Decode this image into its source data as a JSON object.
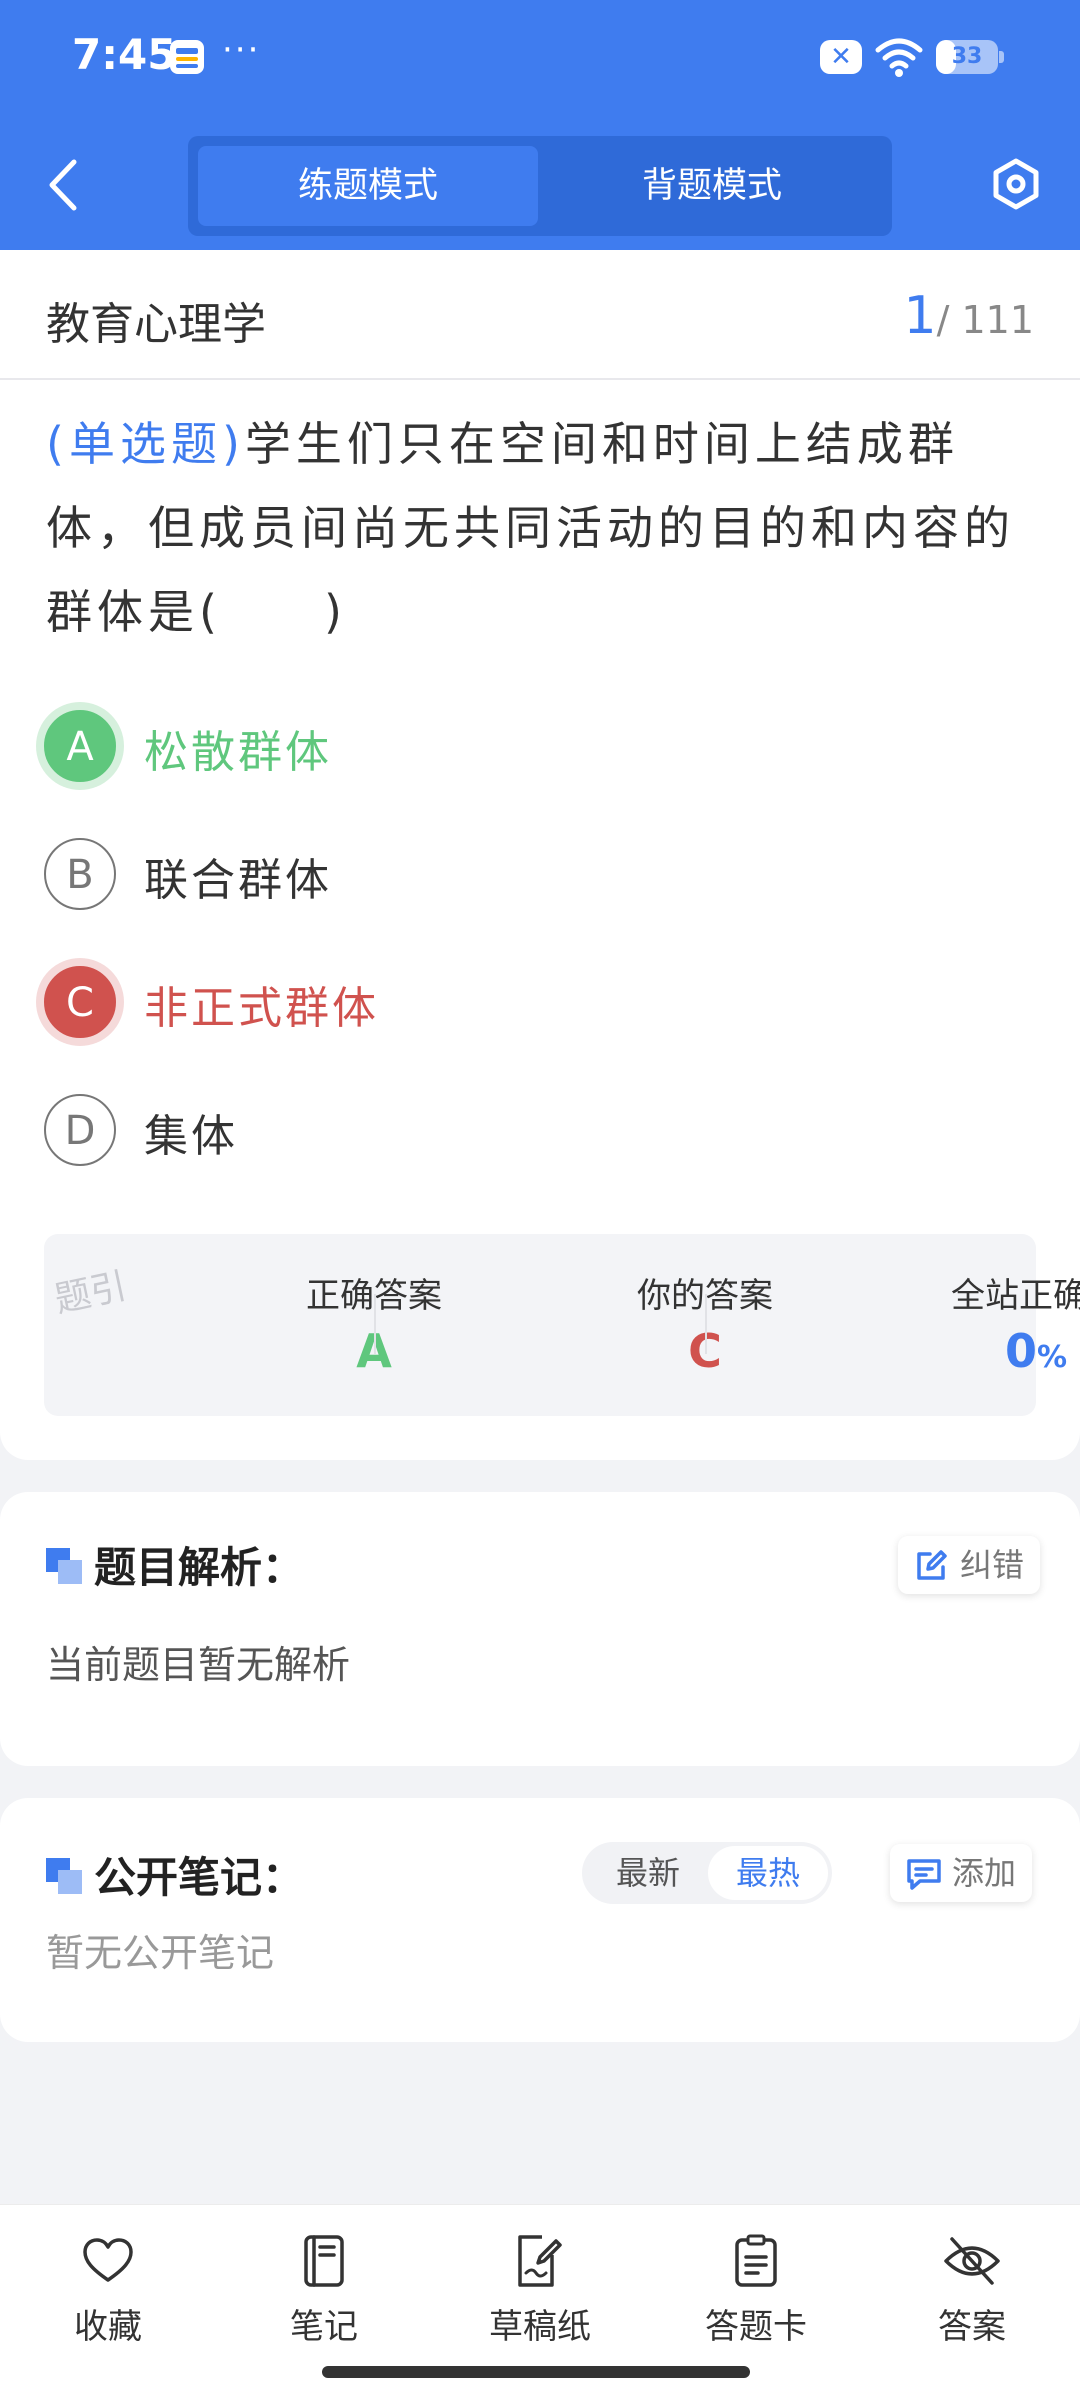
{
  "status_bar": {
    "time": "7:45",
    "dots": "···",
    "battery": "33",
    "battery_level": 0.33
  },
  "header": {
    "modes": [
      {
        "label": "练题模式",
        "active": true
      },
      {
        "label": "背题模式",
        "active": false
      }
    ]
  },
  "title_row": {
    "subject": "教育心理学",
    "current": "1",
    "total": "/ 111"
  },
  "question": {
    "type_label": "(单选题)",
    "text": "学生们只在空间和时间上结成群体，但成员间尚无共同活动的目的和内容的群体是(　　)",
    "options": [
      {
        "letter": "A",
        "text": "松散群体",
        "state": "correct"
      },
      {
        "letter": "B",
        "text": "联合群体",
        "state": "normal"
      },
      {
        "letter": "C",
        "text": "非正式群体",
        "state": "wrong"
      },
      {
        "letter": "D",
        "text": "集体",
        "state": "normal"
      }
    ]
  },
  "answer_summary": {
    "watermark": "题引",
    "correct_label": "正确答案",
    "correct_value": "A",
    "yours_label": "你的答案",
    "yours_value": "C",
    "rate_label": "全站正确率",
    "rate_value": "0",
    "rate_unit": "%"
  },
  "analysis": {
    "title": "题目解析：",
    "report_label": "纠错",
    "empty_text": "当前题目暂无解析"
  },
  "notes": {
    "title": "公开笔记：",
    "sort_latest": "最新",
    "sort_hot": "最热",
    "add_label": "添加",
    "empty_text": "暂无公开笔记"
  },
  "bottom_nav": {
    "items": [
      {
        "label": "收藏",
        "icon": "heart-icon"
      },
      {
        "label": "笔记",
        "icon": "notebook-icon"
      },
      {
        "label": "草稿纸",
        "icon": "draft-paper-icon"
      },
      {
        "label": "答题卡",
        "icon": "answer-card-icon"
      },
      {
        "label": "答案",
        "icon": "eye-off-icon"
      }
    ]
  },
  "colors": {
    "brand": "#3f7cef",
    "correct": "#5fc77d",
    "wrong": "#d0524e"
  }
}
